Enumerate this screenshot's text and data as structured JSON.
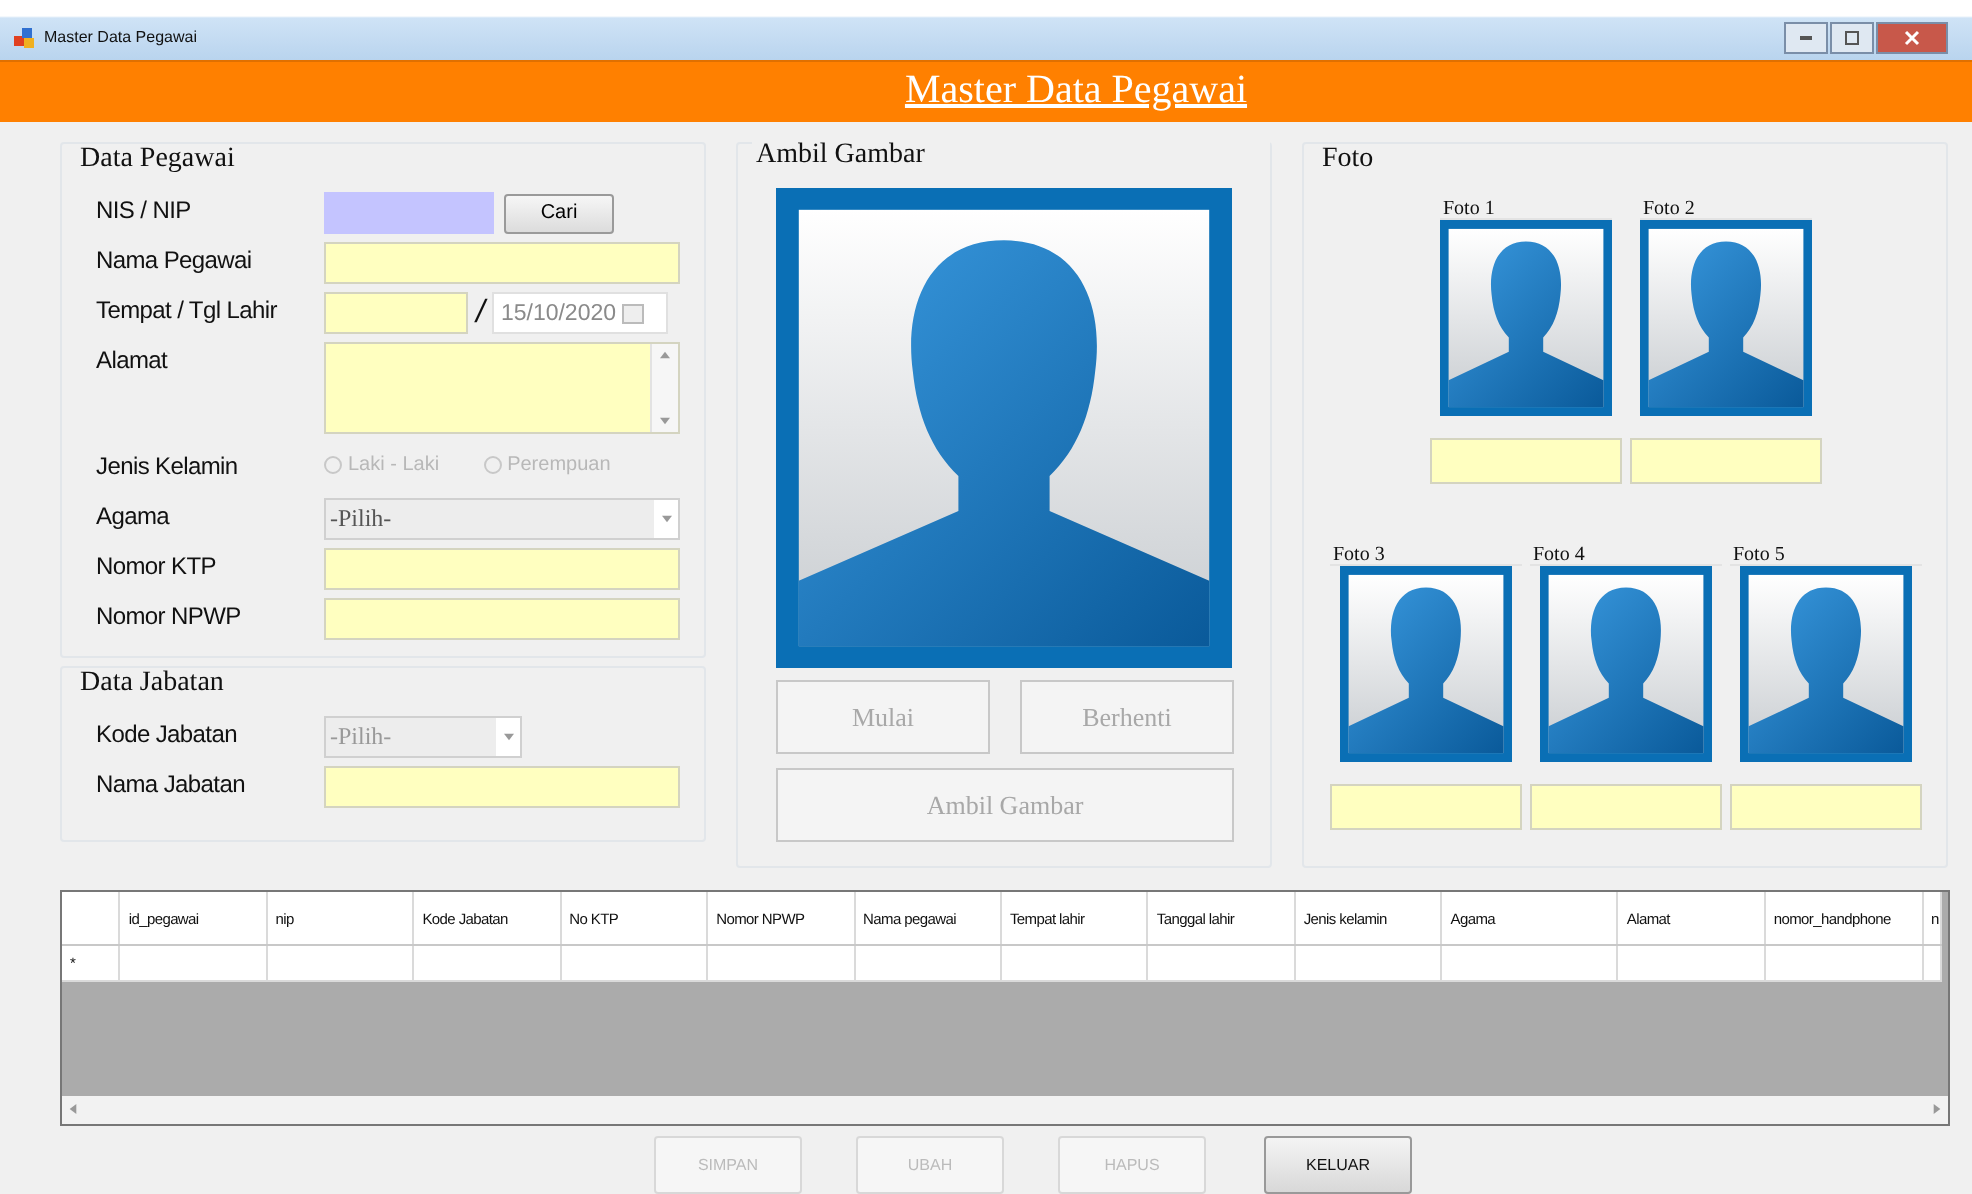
{
  "window": {
    "title": "Master Data Pegawai"
  },
  "header": {
    "title": "Master Data Pegawai"
  },
  "data_pegawai": {
    "title": "Data Pegawai",
    "fields": [
      {
        "kind": "search",
        "label": "NIS / NIP",
        "button": "Cari"
      },
      {
        "kind": "text",
        "label": "Nama Pegawai"
      },
      {
        "kind": "place_date",
        "label": "Tempat /  Tgl Lahir",
        "separator": "/",
        "date": "15/10/2020",
        "disabled": true
      },
      {
        "kind": "memo",
        "label": "Alamat"
      },
      {
        "kind": "radio",
        "label": "Jenis Kelamin",
        "disabled": true,
        "options": [
          {
            "label": "Laki - Laki",
            "selected": false
          },
          {
            "label": "Perempuan",
            "selected": false
          }
        ]
      },
      {
        "kind": "combo",
        "label": "Agama",
        "value": "-Pilih-",
        "disabled": false
      },
      {
        "kind": "text",
        "label": "Nomor KTP"
      },
      {
        "kind": "text",
        "label": "Nomor NPWP"
      }
    ]
  },
  "data_jabatan": {
    "title": "Data Jabatan",
    "fields": [
      {
        "kind": "combo",
        "label": "Kode Jabatan",
        "value": "-Pilih-",
        "disabled": true
      },
      {
        "kind": "text",
        "label": "Nama Jabatan"
      }
    ]
  },
  "ambil_gambar": {
    "title": "Ambil Gambar",
    "buttons": [
      {
        "label": "Mulai",
        "disabled": true
      },
      {
        "label": "Berhenti",
        "disabled": true
      },
      {
        "label": "Ambil Gambar",
        "disabled": true
      }
    ]
  },
  "foto": {
    "title": "Foto",
    "rows": [
      [
        {
          "label": "Foto 1"
        },
        {
          "label": "Foto 2"
        }
      ],
      [
        {
          "label": "Foto 3"
        },
        {
          "label": "Foto 4"
        },
        {
          "label": "Foto 5"
        }
      ]
    ]
  },
  "table": {
    "columns": [
      "id_pegawai",
      "nip",
      "Kode Jabatan",
      "No KTP",
      "Nomor NPWP",
      "Nama pegawai",
      "Tempat lahir",
      "Tanggal lahir",
      "Jenis kelamin",
      "Agama",
      "Alamat",
      "nomor_handphone",
      "n"
    ],
    "new_row_marker": "*"
  },
  "buttons": [
    {
      "label": "SIMPAN",
      "disabled": true
    },
    {
      "label": "UBAH",
      "disabled": true
    },
    {
      "label": "HAPUS",
      "disabled": true
    },
    {
      "label": "KELUAR",
      "disabled": false
    }
  ]
}
